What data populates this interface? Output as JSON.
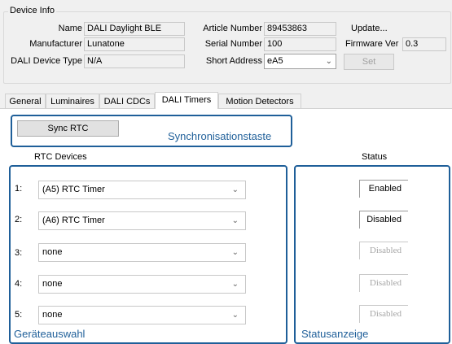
{
  "device_info": {
    "legend": "Device Info",
    "name_label": "Name",
    "name_value": "DALI Daylight BLE",
    "manufacturer_label": "Manufacturer",
    "manufacturer_value": "Lunatone",
    "dali_type_label": "DALI Device Type",
    "dali_type_value": "N/A",
    "article_label": "Article Number",
    "article_value": "89453863",
    "serial_label": "Serial Number",
    "serial_value": "100",
    "short_address_label": "Short Address",
    "short_address_value": "eA5",
    "update_label": "Update...",
    "firmware_label": "Firmware Ver",
    "firmware_value": "0.3",
    "set_label": "Set"
  },
  "tabs": [
    {
      "label": "General"
    },
    {
      "label": "Luminaires"
    },
    {
      "label": "DALI CDCs"
    },
    {
      "label": "DALI Timers",
      "active": true
    },
    {
      "label": "Motion Detectors"
    }
  ],
  "timers": {
    "sync_button": "Sync RTC",
    "rtc_header": "RTC Devices",
    "status_header": "Status",
    "rows": [
      {
        "num": "1:",
        "device": "(A5) RTC Timer",
        "status": "Enabled",
        "status_enabled": true
      },
      {
        "num": "2:",
        "device": "(A6) RTC Timer",
        "status": "Disabled",
        "status_enabled": true
      },
      {
        "num": "3:",
        "device": "none",
        "status": "Disabled",
        "status_enabled": false
      },
      {
        "num": "4:",
        "device": "none",
        "status": "Disabled",
        "status_enabled": false
      },
      {
        "num": "5:",
        "device": "none",
        "status": "Disabled",
        "status_enabled": false
      }
    ]
  },
  "annotations": {
    "sync": "Synchronisationstaste",
    "device_select": "Geräteauswahl",
    "status_display": "Statusanzeige",
    "color": "#1f5f99"
  },
  "icons": {
    "dropdown": "chevron-down-icon"
  }
}
